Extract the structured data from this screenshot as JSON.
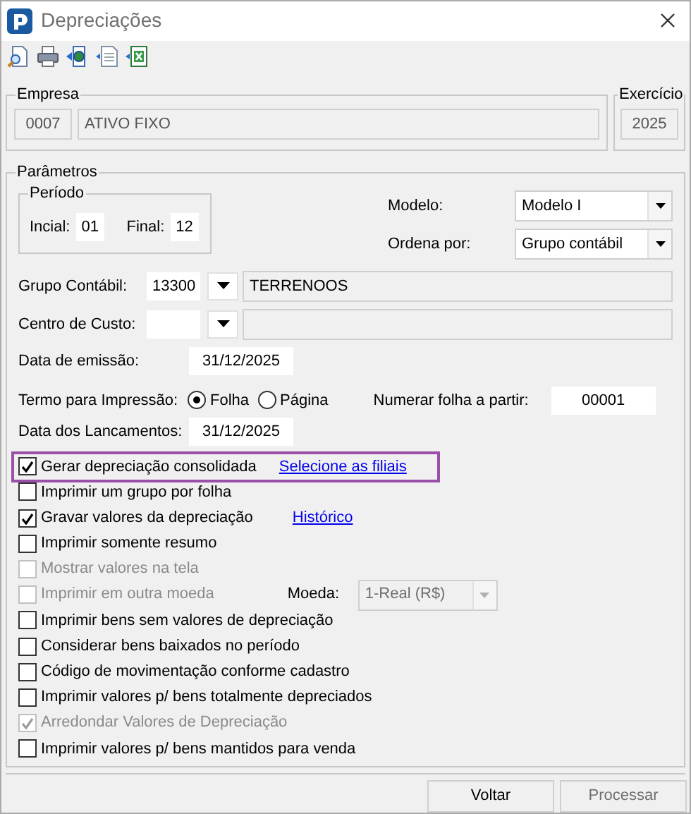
{
  "window": {
    "title": "Depreciações"
  },
  "toolbar": [
    {
      "kind": "preview"
    },
    {
      "kind": "print"
    },
    {
      "kind": "export"
    },
    {
      "kind": "text"
    },
    {
      "kind": "excel"
    }
  ],
  "empresa": {
    "label": "Empresa",
    "code": "0007",
    "name": "ATIVO FIXO"
  },
  "exercicio": {
    "label": "Exercício",
    "value": "2025"
  },
  "parametros": {
    "label": "Parâmetros",
    "periodo": {
      "label": "Período",
      "start_label": "Incial:",
      "start": "01",
      "end_label": "Final:",
      "end": "12"
    },
    "modelo": {
      "label": "Modelo:",
      "value": "Modelo I"
    },
    "ordena": {
      "label": "Ordena por:",
      "value": "Grupo contábil"
    },
    "grupo": {
      "label": "Grupo Contábil:",
      "code": "13300",
      "name": "TERRENOOS"
    },
    "centro": {
      "label": "Centro de Custo:"
    },
    "emissao": {
      "label": "Data de emissão:",
      "value": "31/12/2025"
    },
    "termo": {
      "label": "Termo para Impressão:",
      "options": [
        {
          "label": "Folha",
          "selected": true
        },
        {
          "label": "Página",
          "selected": false
        }
      ]
    },
    "numerar": {
      "label": "Numerar folha a partir:",
      "value": "00001"
    },
    "lancamentos": {
      "label": "Data dos Lancamentos:",
      "value": "31/12/2025"
    },
    "options": [
      {
        "label": "Gerar depreciação consolidada",
        "checked": true,
        "disabled": false,
        "highlighted": true,
        "link": "Selecione as filiais"
      },
      {
        "label": "Imprimir um grupo por folha",
        "checked": false,
        "disabled": false,
        "highlighted": false
      },
      {
        "label": "Gravar valores da depreciação",
        "checked": true,
        "disabled": false,
        "highlighted": false,
        "link": "Histórico"
      },
      {
        "label": "Imprimir somente resumo",
        "checked": false,
        "disabled": false,
        "highlighted": false
      },
      {
        "label": "Mostrar valores na tela",
        "checked": false,
        "disabled": true,
        "highlighted": false
      },
      {
        "label": "Imprimir em outra moeda",
        "checked": false,
        "disabled": true,
        "highlighted": false,
        "currency": {
          "label": "Moeda:",
          "value": "1-Real (R$)",
          "disabled": true
        }
      },
      {
        "label": "Imprimir bens sem valores de depreciação",
        "checked": false,
        "disabled": false,
        "highlighted": false
      },
      {
        "label": "Considerar bens baixados no período",
        "checked": false,
        "disabled": false,
        "highlighted": false
      },
      {
        "label": "Código de movimentação conforme cadastro",
        "checked": false,
        "disabled": false,
        "highlighted": false
      },
      {
        "label": "Imprimir valores p/ bens totalmente depreciados",
        "checked": false,
        "disabled": false,
        "highlighted": false
      },
      {
        "label": "Arredondar Valores de Depreciação",
        "checked": true,
        "disabled": true,
        "highlighted": false
      },
      {
        "label": "Imprimir valores p/ bens mantidos para venda",
        "checked": false,
        "disabled": false,
        "highlighted": false
      }
    ]
  },
  "buttons": [
    {
      "label": "Voltar",
      "disabled": false
    },
    {
      "label": "Processar",
      "disabled": true
    }
  ]
}
